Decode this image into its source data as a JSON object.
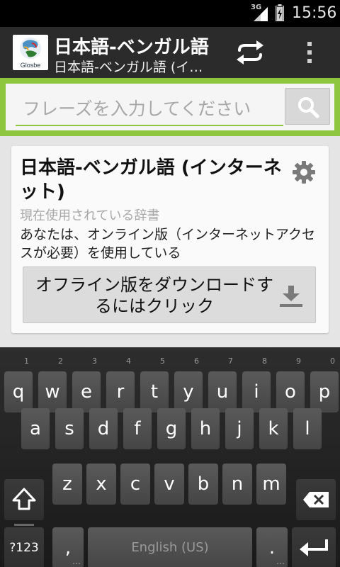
{
  "status_bar": {
    "network": "3G",
    "time": "15:56"
  },
  "action_bar": {
    "logo_label": "Glosbe",
    "title": "日本語-ベンガル語",
    "subtitle": "日本語-ベンガル語 (イ…"
  },
  "search": {
    "placeholder": "フレーズを入力してください"
  },
  "card": {
    "dictionary_name": "日本語-ベンガル語 (インターネット)",
    "current_label": "現在使用されている辞書",
    "status_text": "あなたは、オンライン版（インターネットアクセスが必要）を使用している",
    "download_label": "オフライン版をダウンロードするにはクリック"
  },
  "keyboard": {
    "row1": [
      {
        "key": "q",
        "hint": "1"
      },
      {
        "key": "w",
        "hint": "2"
      },
      {
        "key": "e",
        "hint": "3"
      },
      {
        "key": "r",
        "hint": "4"
      },
      {
        "key": "t",
        "hint": "5"
      },
      {
        "key": "y",
        "hint": "6"
      },
      {
        "key": "u",
        "hint": "7"
      },
      {
        "key": "i",
        "hint": "8"
      },
      {
        "key": "o",
        "hint": "9"
      },
      {
        "key": "p",
        "hint": "0"
      }
    ],
    "row2": [
      "a",
      "s",
      "d",
      "f",
      "g",
      "h",
      "j",
      "k",
      "l"
    ],
    "row3": [
      "z",
      "x",
      "c",
      "v",
      "b",
      "n",
      "m"
    ],
    "symbols_label": "?123",
    "comma_label": ",",
    "space_label": "English (US)",
    "period_label": ".",
    "more_indicator": "…"
  },
  "colors": {
    "accent_green": "#8ec63f",
    "action_bar": "#2b2b2b"
  }
}
